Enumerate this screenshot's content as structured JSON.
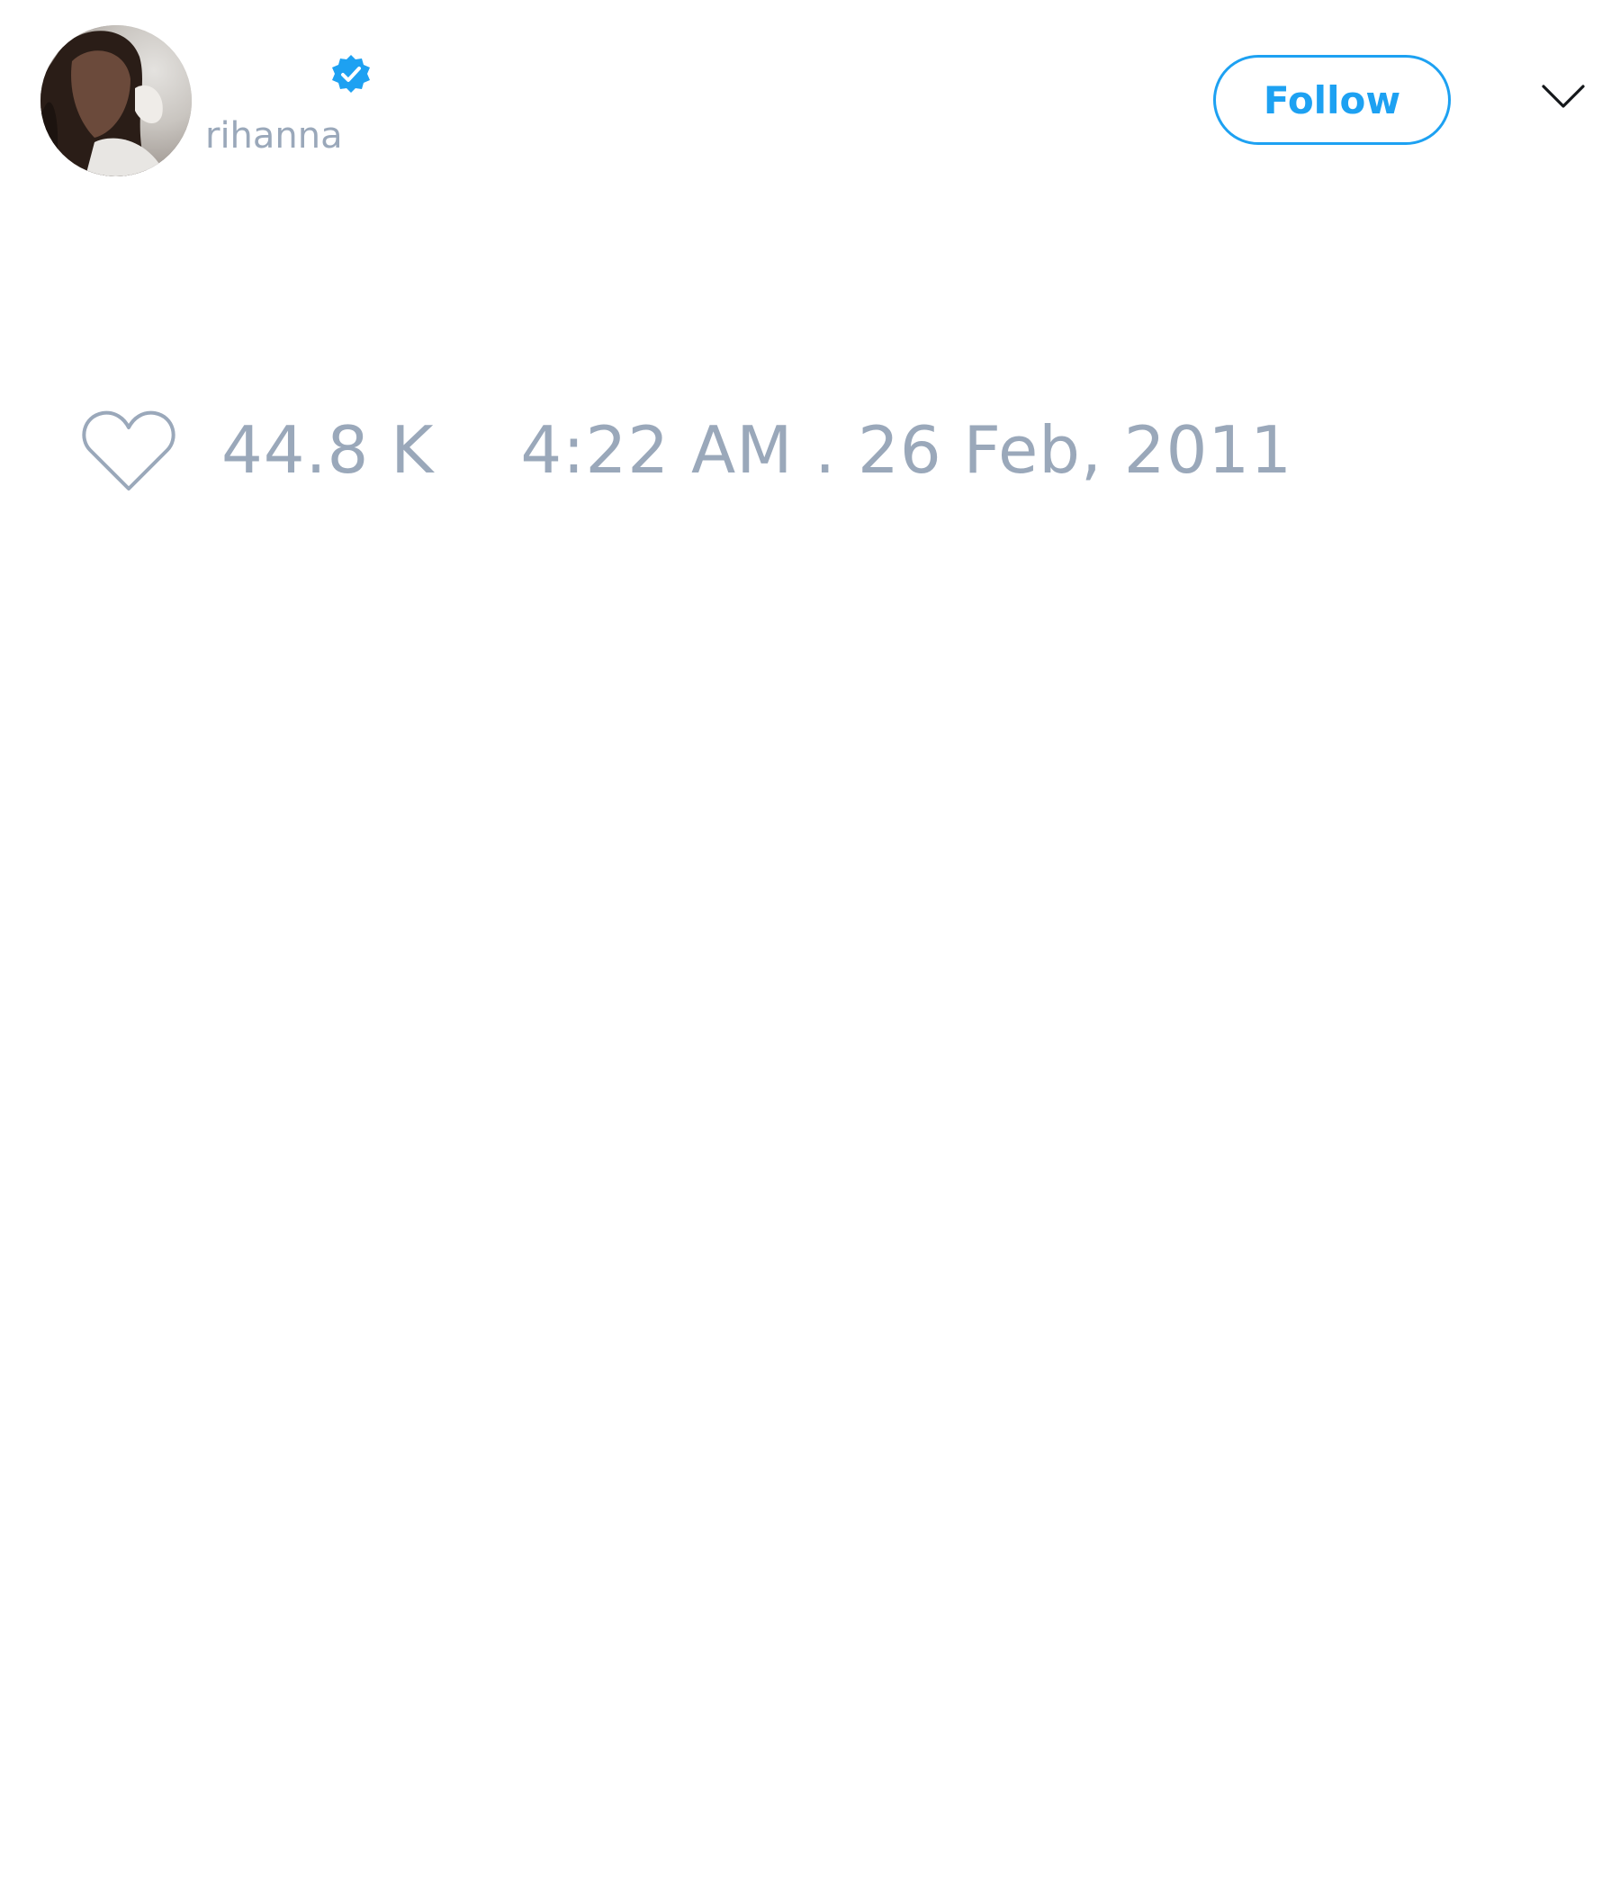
{
  "tweet": {
    "author": {
      "display_name": "",
      "handle": "rihanna",
      "verified": true,
      "avatar_icon": "profile-photo"
    },
    "follow_label": "Follow",
    "menu_icon": "chevron-down-icon",
    "like_icon": "heart-icon",
    "like_count": "44.8 K",
    "timestamp": "4:22 AM . 26 Feb, 2011"
  },
  "colors": {
    "accent": "#1da1f2",
    "muted_text": "#9aa8ba",
    "background": "#ffffff"
  }
}
